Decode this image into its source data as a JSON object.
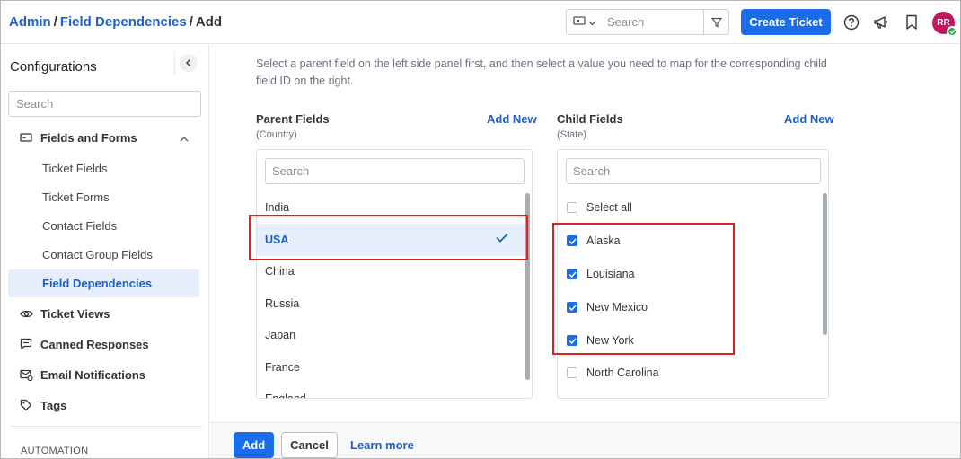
{
  "header": {
    "breadcrumb": [
      "Admin",
      "Field Dependencies",
      "Add"
    ],
    "search_placeholder": "Search",
    "create_ticket_label": "Create Ticket",
    "avatar_initials": "RR"
  },
  "sidebar": {
    "title": "Configurations",
    "search_placeholder": "Search",
    "groups": [
      {
        "label": "Fields and Forms",
        "icon": "form-icon",
        "expanded": true
      },
      {
        "label": "Ticket Views",
        "icon": "eye-icon"
      },
      {
        "label": "Canned Responses",
        "icon": "chat-icon"
      },
      {
        "label": "Email Notifications",
        "icon": "email-settings-icon"
      },
      {
        "label": "Tags",
        "icon": "tag-icon"
      }
    ],
    "sub_items": [
      "Ticket Fields",
      "Ticket Forms",
      "Contact Fields",
      "Contact Group Fields",
      "Field Dependencies"
    ],
    "active_sub_item": "Field Dependencies",
    "section_label": "AUTOMATION"
  },
  "main": {
    "instructions": "Select a parent field on the left side panel first, and then select a value you need to map for the corresponding child field ID on the right.",
    "parent": {
      "title": "Parent Fields",
      "subtitle": "(Country)",
      "add_new": "Add New",
      "search_placeholder": "Search",
      "items": [
        "India",
        "USA",
        "China",
        "Russia",
        "Japan",
        "France",
        "England"
      ],
      "selected": "USA"
    },
    "child": {
      "title": "Child Fields",
      "subtitle": "(State)",
      "add_new": "Add New",
      "search_placeholder": "Search",
      "select_all_label": "Select all",
      "items": [
        {
          "label": "Alaska",
          "checked": true
        },
        {
          "label": "Louisiana",
          "checked": true
        },
        {
          "label": "New Mexico",
          "checked": true
        },
        {
          "label": "New York",
          "checked": true
        },
        {
          "label": "North Carolina",
          "checked": false
        }
      ]
    }
  },
  "footer": {
    "add_label": "Add",
    "cancel_label": "Cancel",
    "learn_more_label": "Learn more"
  },
  "colors": {
    "primary": "#1a6ce8",
    "link": "#1f5fc9",
    "highlight": "#e02020",
    "selected_row": "#e8effc"
  }
}
